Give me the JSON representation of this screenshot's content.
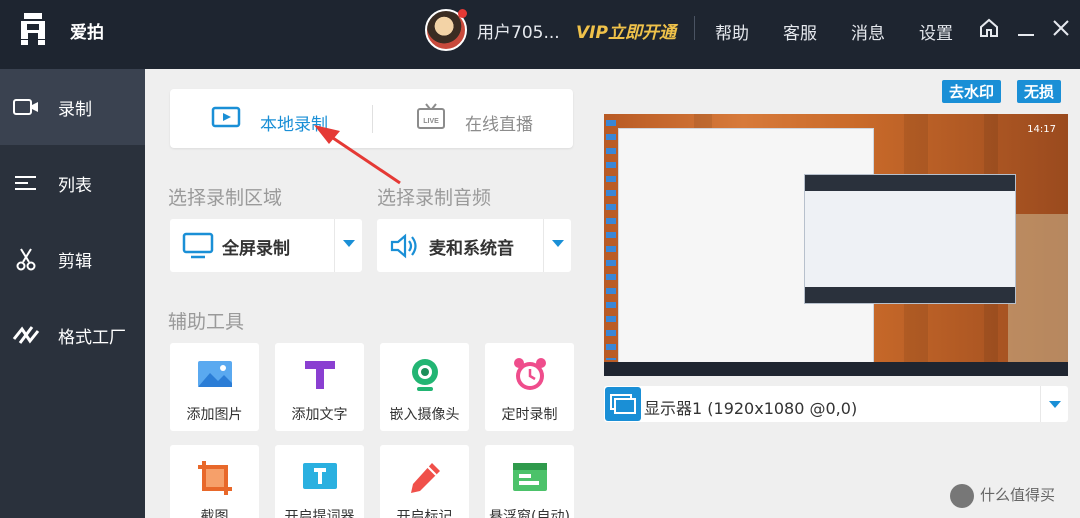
{
  "app": {
    "title": "爱拍"
  },
  "user": {
    "name": "用户705...",
    "vip_label": "VIP立即开通"
  },
  "top_nav": {
    "help": "帮助",
    "service": "客服",
    "messages": "消息",
    "settings": "设置"
  },
  "sidebar": {
    "items": [
      {
        "label": "录制",
        "icon": "camera-icon",
        "active": true
      },
      {
        "label": "列表",
        "icon": "list-icon",
        "active": false
      },
      {
        "label": "剪辑",
        "icon": "scissors-icon",
        "active": false
      },
      {
        "label": "格式工厂",
        "icon": "convert-icon",
        "active": false
      }
    ]
  },
  "mode_tabs": {
    "local": {
      "label": "本地录制",
      "active": true
    },
    "live": {
      "label": "在线直播",
      "icon_text": "LIVE",
      "active": false
    }
  },
  "region": {
    "title": "选择录制区域",
    "value": "全屏录制"
  },
  "audio": {
    "title": "选择录制音频",
    "value": "麦和系统音"
  },
  "tools": {
    "title": "辅助工具",
    "items": [
      {
        "label": "添加图片",
        "icon": "image-icon"
      },
      {
        "label": "添加文字",
        "icon": "text-icon"
      },
      {
        "label": "嵌入摄像头",
        "icon": "webcam-icon"
      },
      {
        "label": "定时录制",
        "icon": "alarm-clock-icon"
      },
      {
        "label": "截图",
        "icon": "crop-icon"
      },
      {
        "label": "开启提词器",
        "icon": "teleprompter-icon"
      },
      {
        "label": "开启标记",
        "icon": "pen-icon"
      },
      {
        "label": "悬浮窗(自动)",
        "icon": "floating-window-icon"
      }
    ]
  },
  "badges": {
    "remove_watermark": "去水印",
    "lossless": "无损"
  },
  "preview": {
    "clock": "14:17"
  },
  "monitor": {
    "label": "显示器1 (1920x1080 @0,0)"
  },
  "watermark": {
    "text": "什么值得买"
  },
  "colors": {
    "accent": "#1a8fd6",
    "topbar": "#1e2530",
    "sidebar": "#2a313c",
    "vip": "#f0c24a",
    "annotation": "#e53935"
  }
}
